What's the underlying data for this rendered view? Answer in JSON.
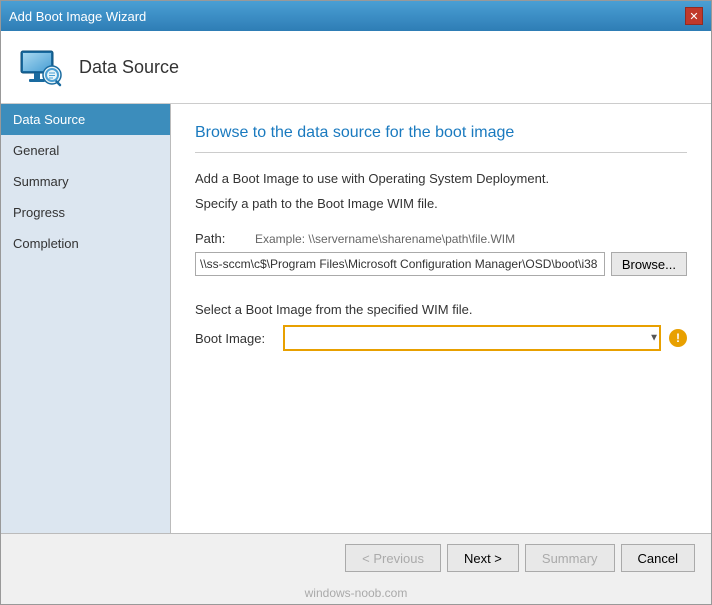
{
  "window": {
    "title": "Add Boot Image Wizard",
    "close_label": "✕"
  },
  "header": {
    "icon_alt": "wizard-icon",
    "title": "Data Source"
  },
  "sidebar": {
    "items": [
      {
        "label": "Data Source",
        "state": "active"
      },
      {
        "label": "General",
        "state": "normal"
      },
      {
        "label": "Summary",
        "state": "normal"
      },
      {
        "label": "Progress",
        "state": "normal"
      },
      {
        "label": "Completion",
        "state": "normal"
      }
    ]
  },
  "content": {
    "heading": "Browse to the data source for the boot image",
    "desc1": "Add a Boot Image to use with Operating System Deployment.",
    "desc2": "Specify a path to the Boot Image WIM file.",
    "path_label": "Path:",
    "path_example": "Example: \\\\servername\\sharename\\path\\file.WIM",
    "path_value": "\\\\ss-sccm\\c$\\Program Files\\Microsoft Configuration Manager\\OSD\\boot\\i38",
    "browse_label": "Browse...",
    "select_desc": "Select a Boot Image from the specified WIM file.",
    "boot_image_label": "Boot Image:",
    "boot_image_value": ""
  },
  "footer": {
    "previous_label": "< Previous",
    "next_label": "Next >",
    "summary_label": "Summary",
    "cancel_label": "Cancel"
  },
  "watermark": "windows-noob.com"
}
